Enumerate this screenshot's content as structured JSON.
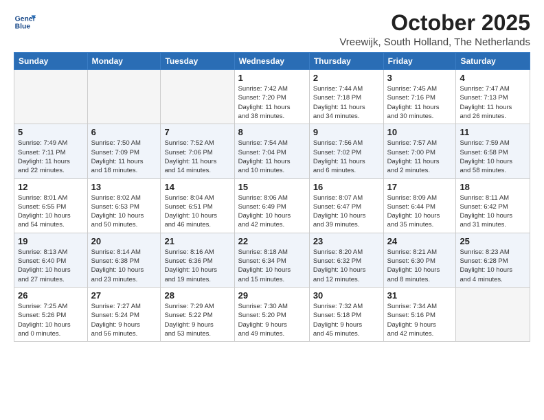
{
  "header": {
    "logo_line1": "General",
    "logo_line2": "Blue",
    "month": "October 2025",
    "location": "Vreewijk, South Holland, The Netherlands"
  },
  "weekdays": [
    "Sunday",
    "Monday",
    "Tuesday",
    "Wednesday",
    "Thursday",
    "Friday",
    "Saturday"
  ],
  "weeks": [
    [
      {
        "day": "",
        "info": ""
      },
      {
        "day": "",
        "info": ""
      },
      {
        "day": "",
        "info": ""
      },
      {
        "day": "1",
        "info": "Sunrise: 7:42 AM\nSunset: 7:20 PM\nDaylight: 11 hours\nand 38 minutes."
      },
      {
        "day": "2",
        "info": "Sunrise: 7:44 AM\nSunset: 7:18 PM\nDaylight: 11 hours\nand 34 minutes."
      },
      {
        "day": "3",
        "info": "Sunrise: 7:45 AM\nSunset: 7:16 PM\nDaylight: 11 hours\nand 30 minutes."
      },
      {
        "day": "4",
        "info": "Sunrise: 7:47 AM\nSunset: 7:13 PM\nDaylight: 11 hours\nand 26 minutes."
      }
    ],
    [
      {
        "day": "5",
        "info": "Sunrise: 7:49 AM\nSunset: 7:11 PM\nDaylight: 11 hours\nand 22 minutes."
      },
      {
        "day": "6",
        "info": "Sunrise: 7:50 AM\nSunset: 7:09 PM\nDaylight: 11 hours\nand 18 minutes."
      },
      {
        "day": "7",
        "info": "Sunrise: 7:52 AM\nSunset: 7:06 PM\nDaylight: 11 hours\nand 14 minutes."
      },
      {
        "day": "8",
        "info": "Sunrise: 7:54 AM\nSunset: 7:04 PM\nDaylight: 11 hours\nand 10 minutes."
      },
      {
        "day": "9",
        "info": "Sunrise: 7:56 AM\nSunset: 7:02 PM\nDaylight: 11 hours\nand 6 minutes."
      },
      {
        "day": "10",
        "info": "Sunrise: 7:57 AM\nSunset: 7:00 PM\nDaylight: 11 hours\nand 2 minutes."
      },
      {
        "day": "11",
        "info": "Sunrise: 7:59 AM\nSunset: 6:58 PM\nDaylight: 10 hours\nand 58 minutes."
      }
    ],
    [
      {
        "day": "12",
        "info": "Sunrise: 8:01 AM\nSunset: 6:55 PM\nDaylight: 10 hours\nand 54 minutes."
      },
      {
        "day": "13",
        "info": "Sunrise: 8:02 AM\nSunset: 6:53 PM\nDaylight: 10 hours\nand 50 minutes."
      },
      {
        "day": "14",
        "info": "Sunrise: 8:04 AM\nSunset: 6:51 PM\nDaylight: 10 hours\nand 46 minutes."
      },
      {
        "day": "15",
        "info": "Sunrise: 8:06 AM\nSunset: 6:49 PM\nDaylight: 10 hours\nand 42 minutes."
      },
      {
        "day": "16",
        "info": "Sunrise: 8:07 AM\nSunset: 6:47 PM\nDaylight: 10 hours\nand 39 minutes."
      },
      {
        "day": "17",
        "info": "Sunrise: 8:09 AM\nSunset: 6:44 PM\nDaylight: 10 hours\nand 35 minutes."
      },
      {
        "day": "18",
        "info": "Sunrise: 8:11 AM\nSunset: 6:42 PM\nDaylight: 10 hours\nand 31 minutes."
      }
    ],
    [
      {
        "day": "19",
        "info": "Sunrise: 8:13 AM\nSunset: 6:40 PM\nDaylight: 10 hours\nand 27 minutes."
      },
      {
        "day": "20",
        "info": "Sunrise: 8:14 AM\nSunset: 6:38 PM\nDaylight: 10 hours\nand 23 minutes."
      },
      {
        "day": "21",
        "info": "Sunrise: 8:16 AM\nSunset: 6:36 PM\nDaylight: 10 hours\nand 19 minutes."
      },
      {
        "day": "22",
        "info": "Sunrise: 8:18 AM\nSunset: 6:34 PM\nDaylight: 10 hours\nand 15 minutes."
      },
      {
        "day": "23",
        "info": "Sunrise: 8:20 AM\nSunset: 6:32 PM\nDaylight: 10 hours\nand 12 minutes."
      },
      {
        "day": "24",
        "info": "Sunrise: 8:21 AM\nSunset: 6:30 PM\nDaylight: 10 hours\nand 8 minutes."
      },
      {
        "day": "25",
        "info": "Sunrise: 8:23 AM\nSunset: 6:28 PM\nDaylight: 10 hours\nand 4 minutes."
      }
    ],
    [
      {
        "day": "26",
        "info": "Sunrise: 7:25 AM\nSunset: 5:26 PM\nDaylight: 10 hours\nand 0 minutes."
      },
      {
        "day": "27",
        "info": "Sunrise: 7:27 AM\nSunset: 5:24 PM\nDaylight: 9 hours\nand 56 minutes."
      },
      {
        "day": "28",
        "info": "Sunrise: 7:29 AM\nSunset: 5:22 PM\nDaylight: 9 hours\nand 53 minutes."
      },
      {
        "day": "29",
        "info": "Sunrise: 7:30 AM\nSunset: 5:20 PM\nDaylight: 9 hours\nand 49 minutes."
      },
      {
        "day": "30",
        "info": "Sunrise: 7:32 AM\nSunset: 5:18 PM\nDaylight: 9 hours\nand 45 minutes."
      },
      {
        "day": "31",
        "info": "Sunrise: 7:34 AM\nSunset: 5:16 PM\nDaylight: 9 hours\nand 42 minutes."
      },
      {
        "day": "",
        "info": ""
      }
    ]
  ]
}
